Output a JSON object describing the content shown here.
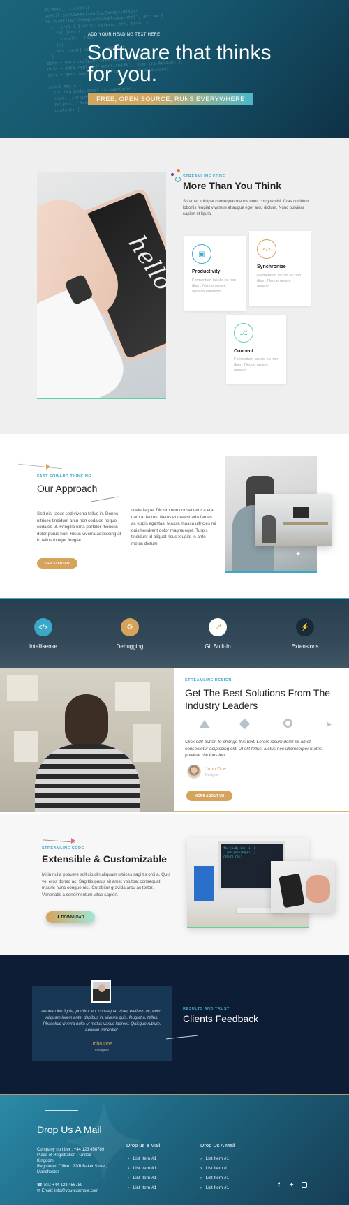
{
  "hero": {
    "eyebrow": "ADD YOUR HEADING TEXT HERE",
    "title": "Software that thinks for you.",
    "tagline": "FREE, OPEN SOURCE, RUNS EVERYWHERE",
    "code_lines": [
      "  $('#set_...).val() ",
      "  sgMail.setApiKey(config.SendgridKey);",
      "  fs.readFile('/templates/welcome.html', err => {",
      "    if (err) { $(err); return, err, data; }",
      "      res.json({",
      "        result: 'fail'",
      "      });",
      "      res.json({ result: 'fail' });",
      "    }",
      "  data = data.replace('%fullname%', formatData);",
      "  data = data.replace('%confirmId%', 'Confirm Account');",
      "  data = data.replace('%userId%', resultData.uuid);",
      "",
      "  const msg = {",
      "    to: req.body.email.toLowerCase(),",
      "    from: 'info@divitech.co.in',",
      "    subject: 'Account Confirmation',",
      "    content: ["
    ]
  },
  "more": {
    "eyebrow": "STREAMLINE CODE",
    "title": "More Than You Think",
    "text": "Sit amet volutpat consequat mauris nunc congue nisi. Cras tincidunt lobortis feugiat vivamus at augue eget arcu dictum. Nunc pulvinar sapien et ligula.",
    "cards": [
      {
        "title": "Productivity",
        "text": "Fermentum iaculis eu non diam. Neque ornare aenean euismod.",
        "icon": "laptop-icon"
      },
      {
        "title": "Synchronize",
        "text": "Fermentum iaculis eu non diam. Neque ornare aenean.",
        "icon": "code-icon"
      },
      {
        "title": "Connect",
        "text": "Fermentum iaculis eu non diam. Neque ornare aenean.",
        "icon": "branch-icon"
      }
    ]
  },
  "approach": {
    "eyebrow": "FAST FOWARD THINKING",
    "title": "Our Approach",
    "col1": "Sed nisi lacus sed viverra tellus in. Donec ultrices tincidunt arcu non sodales neque sodales ut. Fringilla urna porttitor rhoncus dolor purus non. Risus viverra adipiscing at in tellus integer feugiat",
    "col2": "scelerisque. Dictum non consectetur a erat nam at lectus. Netus et malesuada fames ac turpis egestas. Massa massa ultricies mi quis hendrerit dolor magna eget. Turpis tincidunt id aliquet risus feugiat in ante metus dictum.",
    "button": "GET STARTED"
  },
  "features": [
    {
      "label": "Intellisense",
      "icon": "code-icon",
      "color": "#3aa8c8"
    },
    {
      "label": "Debugging",
      "icon": "bug-icon",
      "color": "#d6a35c"
    },
    {
      "label": "Git Built-In",
      "icon": "git-branch-icon",
      "color": "#ffffff"
    },
    {
      "label": "Extensions",
      "icon": "bolt-icon",
      "color": "#1b2a38"
    }
  ],
  "solutions": {
    "eyebrow": "STREAMLINE DESIGN",
    "title": "Get The Best Solutions From The Industry Leaders",
    "quote": "Click edit button to change this text. Lorem ipsum dolor sit amet, consectetur adipiscing elit. Ut elit tellus, luctus nec ullamcorper mattis, pulvinar dapibus leo.",
    "author": "John Doe",
    "author_role": "Designer",
    "button": "MORE ABOUT US",
    "logos": [
      "mountain-logo-icon",
      "diamond-logo-icon",
      "circle-logo-icon",
      "bird-logo-icon"
    ]
  },
  "extensible": {
    "eyebrow": "STREAMLINE CODE",
    "title": "Extensible & Customizable",
    "text": "Mi in nulla posuere sollicitudin aliquam ultrices sagittis orci a. Quis vel eros donec ac. Sagittis purus sit amet volutpat consequat mauris nunc congue nisi. Curabitur gravida arcu ac tortor. Venenatis a condimentum vitae sapien.",
    "button": "DOWNLOAD"
  },
  "testimonial": {
    "quote": "Aenean leo ligula, porttitor eu, consequat vitae, eleifend ac, enim. Aliquam lorem ante, dapibus in, viverra quis, feugiat a, tellus. Phasellus viverra nulla ut metus varius laoreet. Quisque rutrum. Aenean imperdiet.",
    "name": "John Doe",
    "role": "Designer",
    "eyebrow": "RESULTS AND TRUST",
    "title": "Clients Feedback"
  },
  "footer": {
    "title": "Drop Us A Mail",
    "company": "Company number : +44 123 456789",
    "place": "Place of Registration : United Kingdom",
    "office": "Registered Office : 22/B Baker Street, Manchester",
    "tel": "Tel.: +44 123 456789",
    "email": "Email: info@yourexample.com",
    "col_heading": "Drop us a Mail",
    "col2_heading": "Drop Us A Mail",
    "list1": [
      "List Item #1",
      "List Item #1",
      "List Item #1",
      "List Item #1"
    ],
    "list2": [
      "List Item #1",
      "List Item #1",
      "List Item #1",
      "List Item #1"
    ],
    "social": [
      "facebook-icon",
      "twitter-icon",
      "instagram-icon"
    ]
  },
  "colors": {
    "gold": "#d6a35c",
    "teal": "#3aa8c8",
    "navy": "#0d1d35"
  }
}
